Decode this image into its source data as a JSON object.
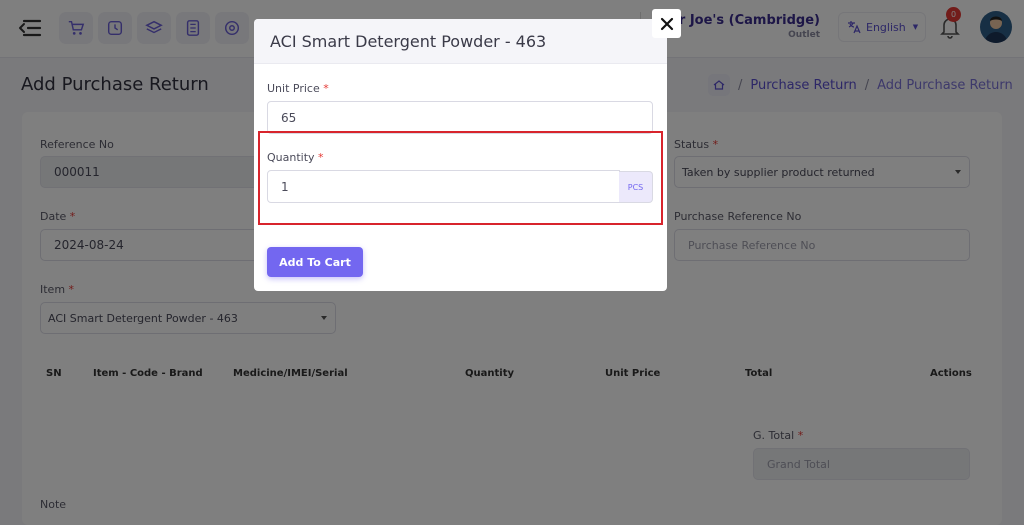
{
  "header": {
    "store_name": "er Joe's (Cambridge)",
    "store_sub": "Outlet",
    "language": "English",
    "notification_count": "0"
  },
  "page": {
    "title": "Add Purchase Return",
    "breadcrumb": [
      "Purchase Return",
      "Add Purchase Return"
    ]
  },
  "form": {
    "reference_label": "Reference No",
    "reference_value": "000011",
    "date_label": "Date",
    "date_value": "2024-08-24",
    "item_label": "Item",
    "item_value": "ACI Smart Detergent Powder - 463",
    "status_label": "Status",
    "status_value": "Taken by supplier product returned",
    "purchase_ref_label": "Purchase Reference No",
    "purchase_ref_placeholder": "Purchase Reference No",
    "gtotal_label": "G. Total",
    "gtotal_placeholder": "Grand Total",
    "note_label": "Note",
    "required_mark": "*"
  },
  "table": {
    "columns": [
      "SN",
      "Item - Code - Brand",
      "Medicine/IMEI/Serial",
      "Quantity",
      "Unit Price",
      "Total",
      "Actions"
    ]
  },
  "modal": {
    "title": "ACI Smart Detergent Powder - 463",
    "unit_price_label": "Unit Price",
    "unit_price_value": "65",
    "quantity_label": "Quantity",
    "quantity_value": "1",
    "unit": "PCS",
    "add_button": "Add To Cart",
    "required_mark": "*"
  },
  "colors": {
    "accent": "#7367f0",
    "highlight": "#d8242c",
    "required": "#e53935"
  },
  "icons": [
    "menu-toggle-icon",
    "cart-icon",
    "clock-icon",
    "layers-icon",
    "calculator-icon",
    "settings-icon",
    "translate-icon",
    "bell-icon",
    "home-icon",
    "close-icon"
  ]
}
